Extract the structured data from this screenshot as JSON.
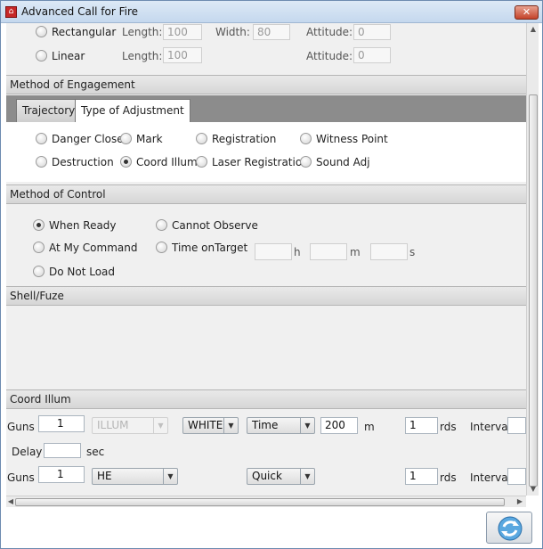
{
  "window": {
    "title": "Advanced Call for Fire",
    "close_label": "✕"
  },
  "target_shape": {
    "rows": [
      {
        "label": "Rectangular",
        "length_label": "Length:",
        "length": "100",
        "width_label": "Width:",
        "width": "80",
        "attitude_label": "Attitude:",
        "attitude": "0"
      },
      {
        "label": "Linear",
        "length_label": "Length:",
        "length": "100",
        "attitude_label": "Attitude:",
        "attitude": "0"
      }
    ]
  },
  "engagement": {
    "header": "Method of Engagement",
    "tabs": [
      {
        "label": "Trajectory"
      },
      {
        "label": "Type of Adjustment",
        "active": true
      }
    ],
    "options": {
      "danger_close": "Danger Close",
      "mark": "Mark",
      "registration": "Registration",
      "witness_point": "Witness Point",
      "destruction": "Destruction",
      "coord_illum": "Coord Illum",
      "laser_registration": "Laser Registration",
      "sound_adj": "Sound Adj"
    },
    "selected": "Coord Illum"
  },
  "control": {
    "header": "Method of Control",
    "options": {
      "when_ready": "When Ready",
      "cannot_observe": "Cannot Observe",
      "at_my_command": "At My Command",
      "time_on_target": "Time onTarget",
      "do_not_load": "Do Not Load"
    },
    "selected": "When Ready",
    "time_units": {
      "h": "h",
      "m": "m",
      "s": "s"
    }
  },
  "shell_fuze": {
    "header": "Shell/Fuze"
  },
  "coord_illum": {
    "header": "Coord Illum",
    "row1": {
      "guns_label": "Guns",
      "guns": "1",
      "shell": "ILLUM",
      "color": "WHITE",
      "fuze": "Time",
      "height": "200",
      "height_unit": "m",
      "rounds": "1",
      "rounds_unit": "rds",
      "interval_label": "Interval"
    },
    "delay": {
      "label": "Delay",
      "unit": "sec"
    },
    "row2": {
      "guns_label": "Guns",
      "guns": "1",
      "shell": "HE",
      "fuze": "Quick",
      "rounds": "1",
      "rounds_unit": "rds",
      "interval_label": "Interval"
    }
  },
  "icons": {
    "app": "app-icon",
    "refresh": "refresh-icon",
    "dropdown": "chevron-down-icon"
  }
}
